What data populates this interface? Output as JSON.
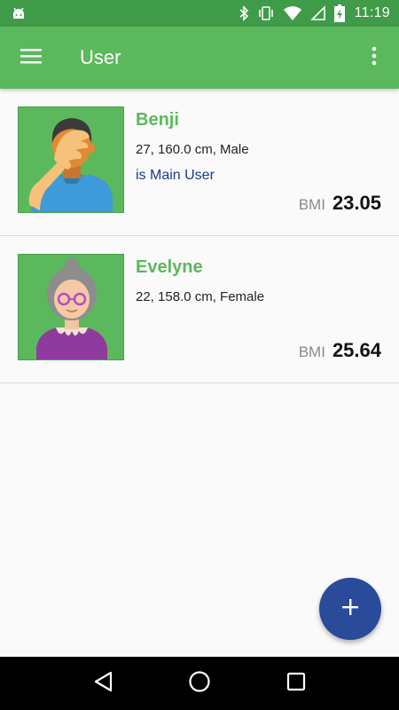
{
  "status_bar": {
    "time": "11:19",
    "icons": [
      "android-icon",
      "bluetooth-icon",
      "vibrate-icon",
      "wifi-icon",
      "no-signal-icon",
      "battery-charging-icon"
    ]
  },
  "app_bar": {
    "title": "User",
    "menu_icon": "hamburger-menu-icon",
    "overflow_icon": "more-vert-icon"
  },
  "users": [
    {
      "name": "Benji",
      "details": "27, 160.0 cm, Male",
      "main_user_label": "is Main User",
      "bmi_label": "BMI",
      "bmi_value": "23.05",
      "avatar_icon": "facepalm-man-avatar-icon"
    },
    {
      "name": "Evelyne",
      "details": "22, 158.0 cm, Female",
      "main_user_label": "",
      "bmi_label": "BMI",
      "bmi_value": "25.64",
      "avatar_icon": "grandmother-avatar-icon"
    }
  ],
  "fab": {
    "icon": "plus-icon"
  },
  "nav_bar": {
    "icons": [
      "back-icon",
      "home-icon",
      "recents-icon"
    ]
  },
  "colors": {
    "status_bar": "#3f9b48",
    "app_bar": "#5cb85c",
    "accent_name": "#5cb85c",
    "main_user_text": "#1a3a8f",
    "fab": "#2a4a9a",
    "avatar_bg": "#5cb85c"
  }
}
